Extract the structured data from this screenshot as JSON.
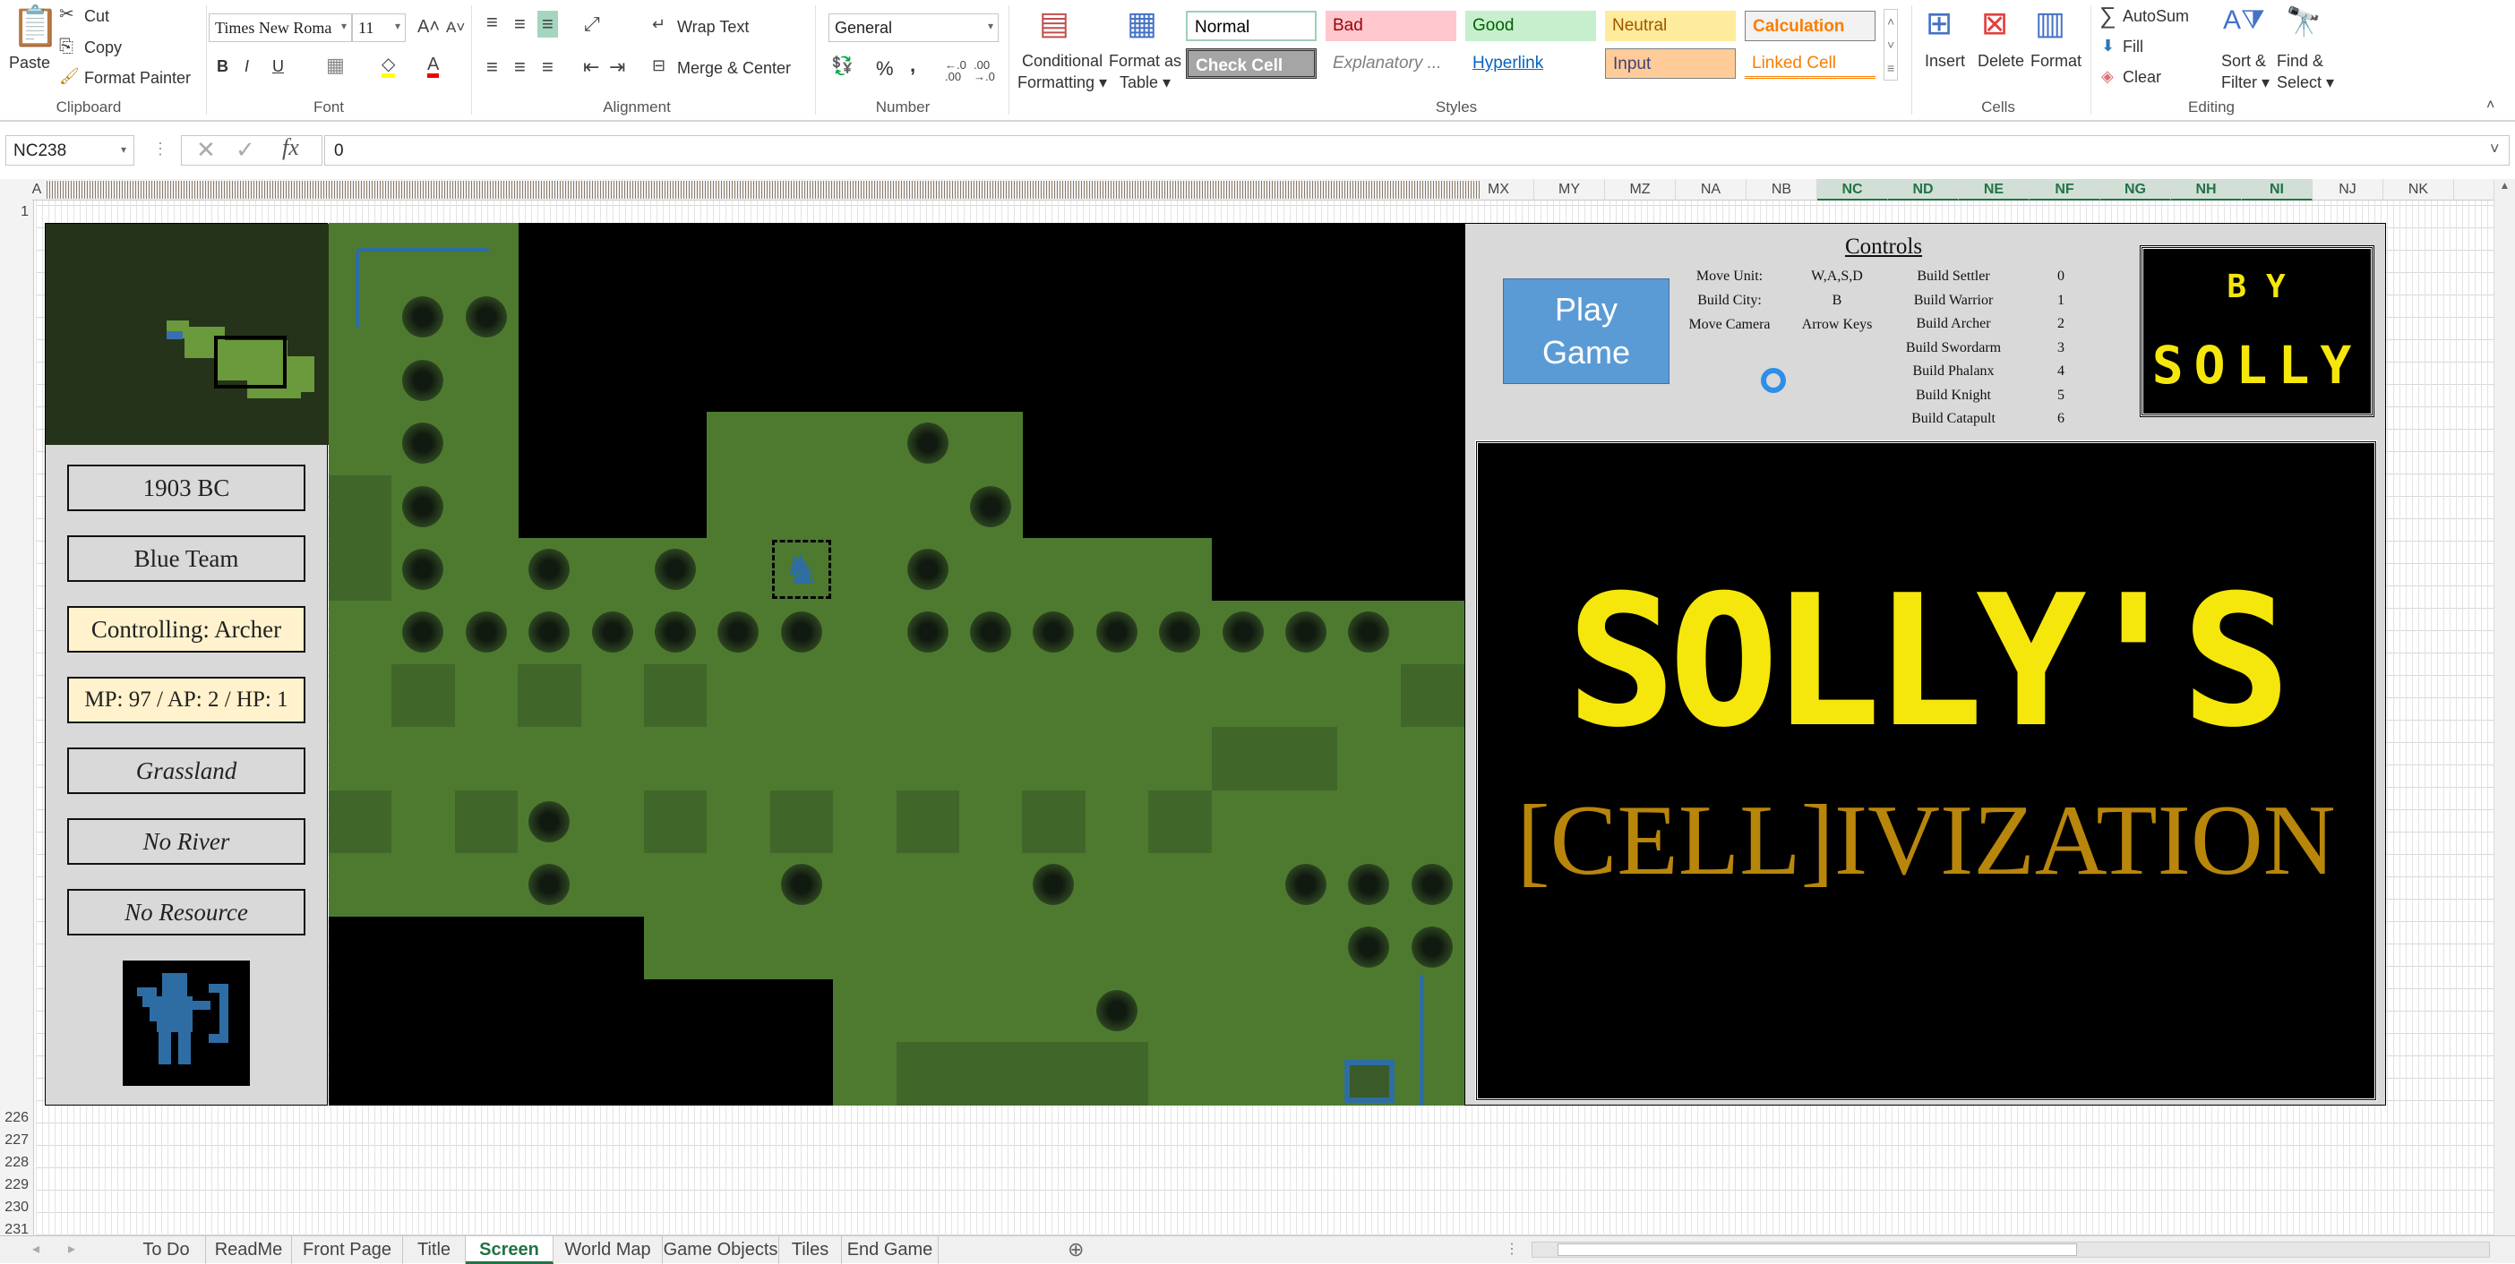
{
  "ribbon": {
    "clipboard": {
      "paste": "Paste",
      "cut": "Cut",
      "copy": "Copy",
      "format_painter": "Format Painter",
      "label": "Clipboard"
    },
    "font": {
      "family": "Times New Roma",
      "size": "11",
      "bold": "B",
      "italic": "I",
      "underline": "U",
      "label": "Font"
    },
    "alignment": {
      "wrap_text": "Wrap Text",
      "merge_center": "Merge & Center",
      "label": "Alignment"
    },
    "number": {
      "format": "General",
      "percent": "%",
      "comma": ",",
      "label": "Number"
    },
    "styles": {
      "conditional_formatting": [
        "Conditional",
        "Formatting"
      ],
      "format_as_table": [
        "Format as",
        "Table"
      ],
      "gallery": [
        {
          "label": "Normal",
          "bg": "#ffffff",
          "fg": "#000000"
        },
        {
          "label": "Bad",
          "bg": "#ffc7ce",
          "fg": "#9c0006"
        },
        {
          "label": "Good",
          "bg": "#c6efce",
          "fg": "#006100"
        },
        {
          "label": "Neutral",
          "bg": "#ffeb9c",
          "fg": "#9c5700"
        },
        {
          "label": "Calculation",
          "bg": "#f2f2f2",
          "fg": "#fa7d00"
        },
        {
          "label": "Check Cell",
          "bg": "#a5a5a5",
          "fg": "#ffffff"
        },
        {
          "label": "Explanatory ...",
          "bg": "#ffffff",
          "fg": "#7f7f7f"
        },
        {
          "label": "Hyperlink",
          "bg": "#ffffff",
          "fg": "#0563c1"
        },
        {
          "label": "Input",
          "bg": "#ffcc99",
          "fg": "#3f3f76"
        },
        {
          "label": "Linked Cell",
          "bg": "#ffffff",
          "fg": "#fa7d00"
        }
      ],
      "label": "Styles"
    },
    "cells": {
      "insert": "Insert",
      "delete": "Delete",
      "format": "Format",
      "label": "Cells"
    },
    "editing": {
      "autosum": "AutoSum",
      "fill": "Fill",
      "clear": "Clear",
      "sort_filter": [
        "Sort &",
        "Filter"
      ],
      "find_select": [
        "Find &",
        "Select"
      ],
      "label": "Editing"
    }
  },
  "formula_bar": {
    "name_box": "NC238",
    "formula": "0"
  },
  "columns": [
    "MX",
    "MY",
    "MZ",
    "NA",
    "NB",
    "NC",
    "ND",
    "NE",
    "NF",
    "NG",
    "NH",
    "NI",
    "NJ",
    "NK"
  ],
  "selected_columns": [
    "NC",
    "ND",
    "NE",
    "NF",
    "NG",
    "NH",
    "NI"
  ],
  "col_a": "A",
  "rows_top": [
    "1"
  ],
  "rows_bottom": [
    "226",
    "227",
    "228",
    "229",
    "230",
    "231"
  ],
  "game": {
    "info": {
      "year": "1903 BC",
      "team": "Blue Team",
      "controlling": "Controlling: Archer",
      "stats": "MP: 97 / AP: 2 / HP: 1",
      "terrain": "Grassland",
      "river": "No River",
      "resource": "No Resource"
    },
    "play_button": [
      "Play",
      "Game"
    ],
    "controls": {
      "title": "Controls",
      "keys": [
        {
          "action": "Move Unit:",
          "key": "W,A,S,D"
        },
        {
          "action": "Build City:",
          "key": "B"
        },
        {
          "action": "Move Camera",
          "key": "Arrow Keys"
        }
      ],
      "builds": [
        {
          "action": "Build Settler",
          "key": "0"
        },
        {
          "action": "Build Warrior",
          "key": "1"
        },
        {
          "action": "Build Archer",
          "key": "2"
        },
        {
          "action": "Build Swordarm",
          "key": "3"
        },
        {
          "action": "Build Phalanx",
          "key": "4"
        },
        {
          "action": "Build Knight",
          "key": "5"
        },
        {
          "action": "Build Catapult",
          "key": "6"
        }
      ]
    },
    "by_box": {
      "by": "BY",
      "author": "SOLLY"
    },
    "title": {
      "main": "SOLLY'S",
      "sub": "[CELL]IVIZATION"
    },
    "colors": {
      "grass": "#4e7a30",
      "tree": "#1e2a18",
      "panel": "#d9d9d9",
      "title_yellow": "#f5e60c",
      "sub_gold": "#b8860b",
      "team_blue": "#2e6da4"
    }
  },
  "sheet_tabs": [
    "To Do",
    "ReadMe",
    "Front Page",
    "Title",
    "Screen",
    "World Map",
    "Game Objects",
    "Tiles",
    "End Game"
  ],
  "active_tab": "Screen"
}
